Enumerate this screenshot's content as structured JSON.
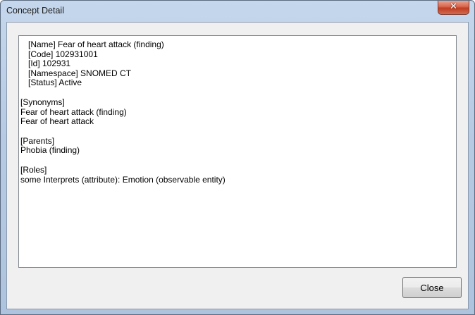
{
  "window": {
    "title": "Concept Detail",
    "close_glyph": "✕"
  },
  "detail": {
    "name_line": "[Name] Fear of heart attack (finding)",
    "code_line": "[Code] 102931001",
    "id_line": "[Id] 102931",
    "namespace_line": "[Namespace] SNOMED CT",
    "status_line": "[Status] Active",
    "synonyms_header": "[Synonyms]",
    "synonyms": [
      "Fear of heart attack (finding)",
      "Fear of heart attack"
    ],
    "parents_header": "[Parents]",
    "parents": [
      "Phobia (finding)"
    ],
    "roles_header": "[Roles]",
    "roles": [
      "some Interprets (attribute): Emotion (observable entity)"
    ]
  },
  "buttons": {
    "close_label": "Close"
  },
  "colors": {
    "titlebar": "#b9cde5",
    "close_red": "#c74a30",
    "dialog_face": "#f0f0f0"
  }
}
